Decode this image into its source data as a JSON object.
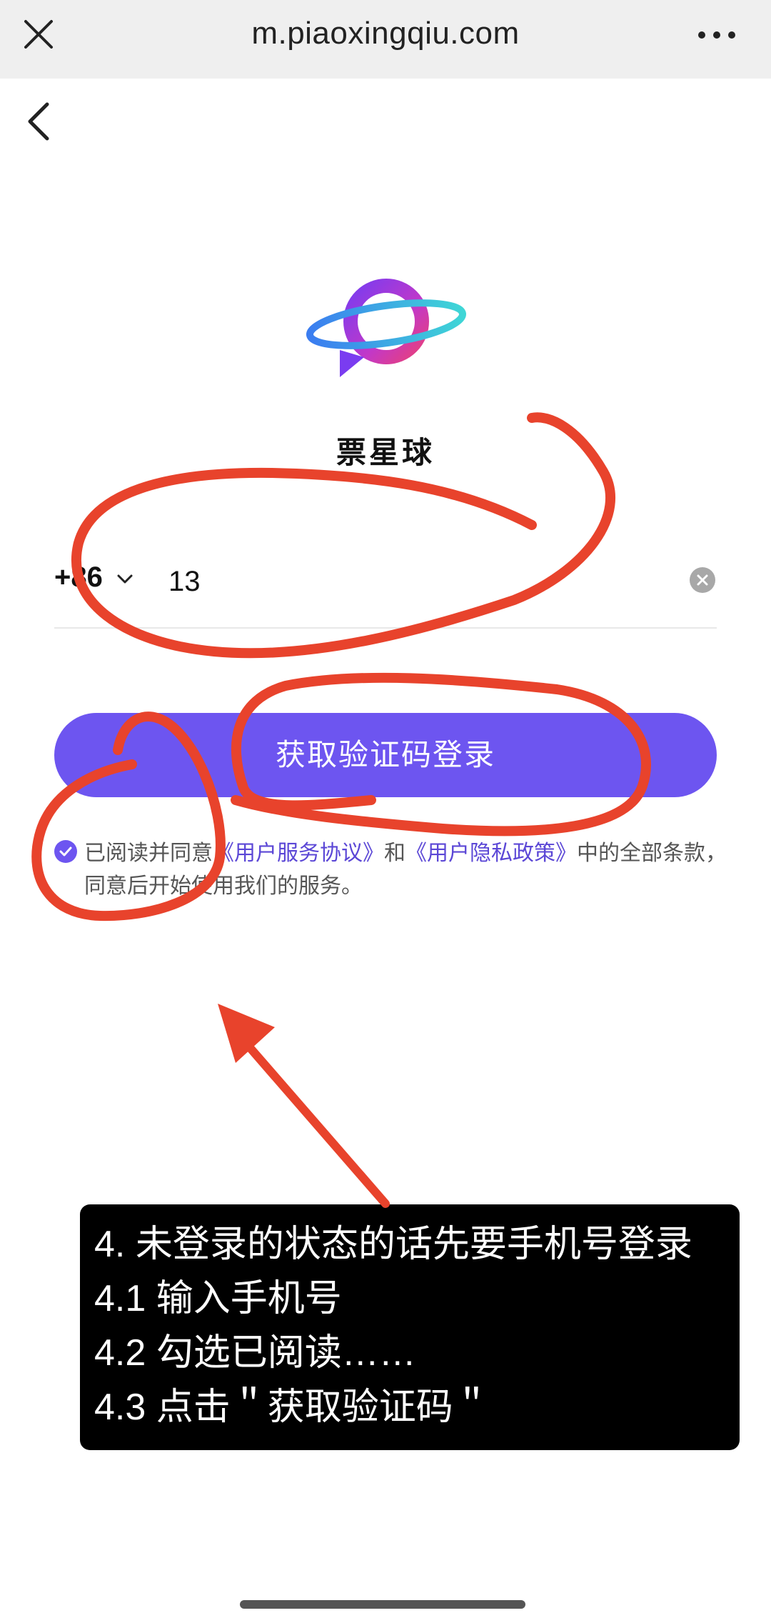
{
  "browser": {
    "url": "m.piaoxingqiu.com"
  },
  "app": {
    "name": "票星球"
  },
  "login": {
    "country_code": "+86",
    "phone_value": "13",
    "phone_placeholder": "",
    "submit_label": "获取验证码登录"
  },
  "agreement": {
    "prefix": "已阅读并同意",
    "terms_link": "《用户服务协议》",
    "conjunction": "和",
    "privacy_link": "《用户隐私政策》",
    "suffix": "中的全部条款，同意后开始使用我们的服务。",
    "checked": true
  },
  "note": {
    "lines": [
      "4. 未登录的状态的话先要手机号登录",
      "4.1 输入手机号",
      "4.2 勾选已阅读……",
      "4.3 点击＂获取验证码＂"
    ]
  },
  "colors": {
    "accent": "#6d55f0",
    "annotation_red": "#e8432c",
    "note_bg": "#000000"
  },
  "icons": [
    "close-icon",
    "more-icon",
    "back-icon",
    "chevron-down-icon",
    "clear-icon",
    "check-icon",
    "app-logo"
  ]
}
